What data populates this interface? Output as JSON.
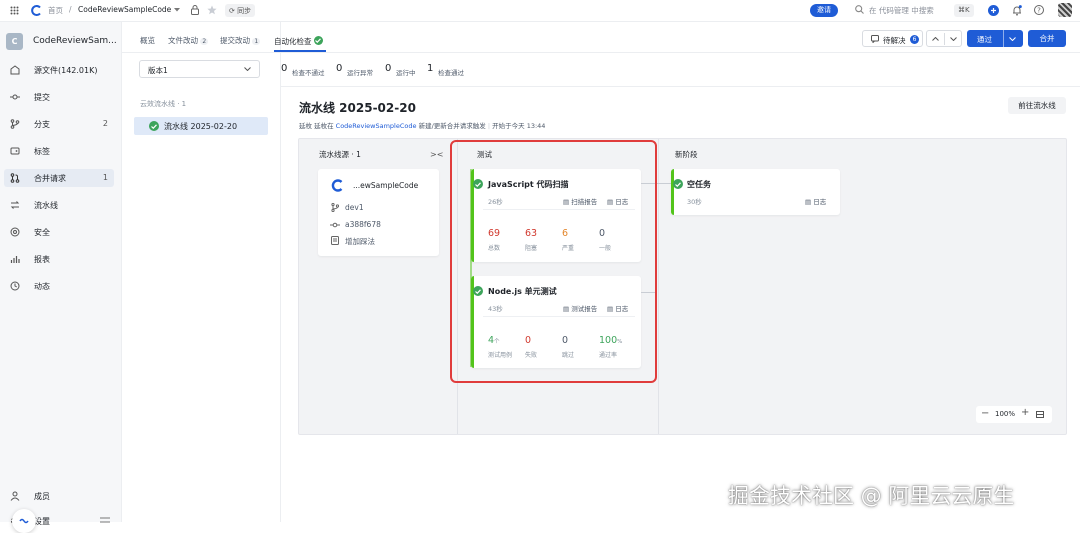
{
  "topbar": {
    "home": "首页",
    "repo": "CodeReviewSampleCode",
    "sync": "同步",
    "invite": "邀请",
    "search_placeholder": "在 代码管理 中搜索",
    "shortcut": "⌘K"
  },
  "sidebar": {
    "repo_initial": "C",
    "repo_name": "CodeReviewSam...",
    "items": [
      {
        "label": "源文件(142.01K)",
        "count": ""
      },
      {
        "label": "提交",
        "count": ""
      },
      {
        "label": "分支",
        "count": "2"
      },
      {
        "label": "标签",
        "count": ""
      },
      {
        "label": "合并请求",
        "count": "1"
      },
      {
        "label": "流水线",
        "count": ""
      },
      {
        "label": "安全",
        "count": ""
      },
      {
        "label": "报表",
        "count": ""
      },
      {
        "label": "动态",
        "count": ""
      }
    ],
    "bottom_members": "成员",
    "bottom_settings": "设置"
  },
  "tabs": [
    {
      "label": "概览",
      "badge": ""
    },
    {
      "label": "文件改动",
      "badge": "2"
    },
    {
      "label": "提交改动",
      "badge": "1"
    },
    {
      "label": "自动化检查",
      "badge": ""
    }
  ],
  "actions": {
    "pending": "待解决",
    "pending_count": "6",
    "approve": "通过",
    "merge": "合并"
  },
  "version_select": "版本1",
  "stats": [
    {
      "num": "0",
      "label": "检查不通过"
    },
    {
      "num": "0",
      "label": "运行异常"
    },
    {
      "num": "0",
      "label": "运行中"
    },
    {
      "num": "1",
      "label": "检查通过"
    }
  ],
  "pipeline_list": {
    "header": "云效流水线 · 1",
    "item": "流水线 2025-02-20"
  },
  "pipeline": {
    "title": "流水线 2025-02-20",
    "meta_prefix": "延枚 延枚在",
    "meta_link": "CodeReviewSampleCode",
    "meta_suffix": "新建/更新合并请求触发",
    "meta_start": "开始于今天 13:44",
    "goto_button": "前往流水线"
  },
  "source_stage": {
    "title": "流水线源 · 1",
    "repo": "...ewSampleCode",
    "branch": "dev1",
    "commit": "a388f678",
    "message": "增加踩法"
  },
  "test_stage": {
    "title": "测试",
    "jobs": [
      {
        "name": "JavaScript 代码扫描",
        "duration": "26秒",
        "link1": "扫描报告",
        "link2": "日志",
        "metrics": [
          {
            "value": "69",
            "label": "总数"
          },
          {
            "value": "63",
            "label": "阻塞"
          },
          {
            "value": "6",
            "label": "严重"
          },
          {
            "value": "0",
            "label": "一般"
          }
        ]
      },
      {
        "name": "Node.js 单元测试",
        "duration": "43秒",
        "link1": "测试报告",
        "link2": "日志",
        "metrics": [
          {
            "value": "4",
            "suffix": "个",
            "label": "测试用例"
          },
          {
            "value": "0",
            "suffix": "",
            "label": "失败"
          },
          {
            "value": "0",
            "suffix": "",
            "label": "跳过"
          },
          {
            "value": "100",
            "suffix": "%",
            "label": "通过率"
          }
        ]
      }
    ]
  },
  "new_stage": {
    "title": "新阶段",
    "job_name": "空任务",
    "duration": "30秒",
    "link": "日志"
  },
  "zoom": "100%",
  "watermark": "掘金技术社区 @ 阿里云云原生",
  "colors": {
    "primary": "#1f5cd6",
    "success": "#3da45b",
    "danger": "#d13a2f",
    "warning": "#e3862b",
    "highlight": "#e03c3c"
  }
}
